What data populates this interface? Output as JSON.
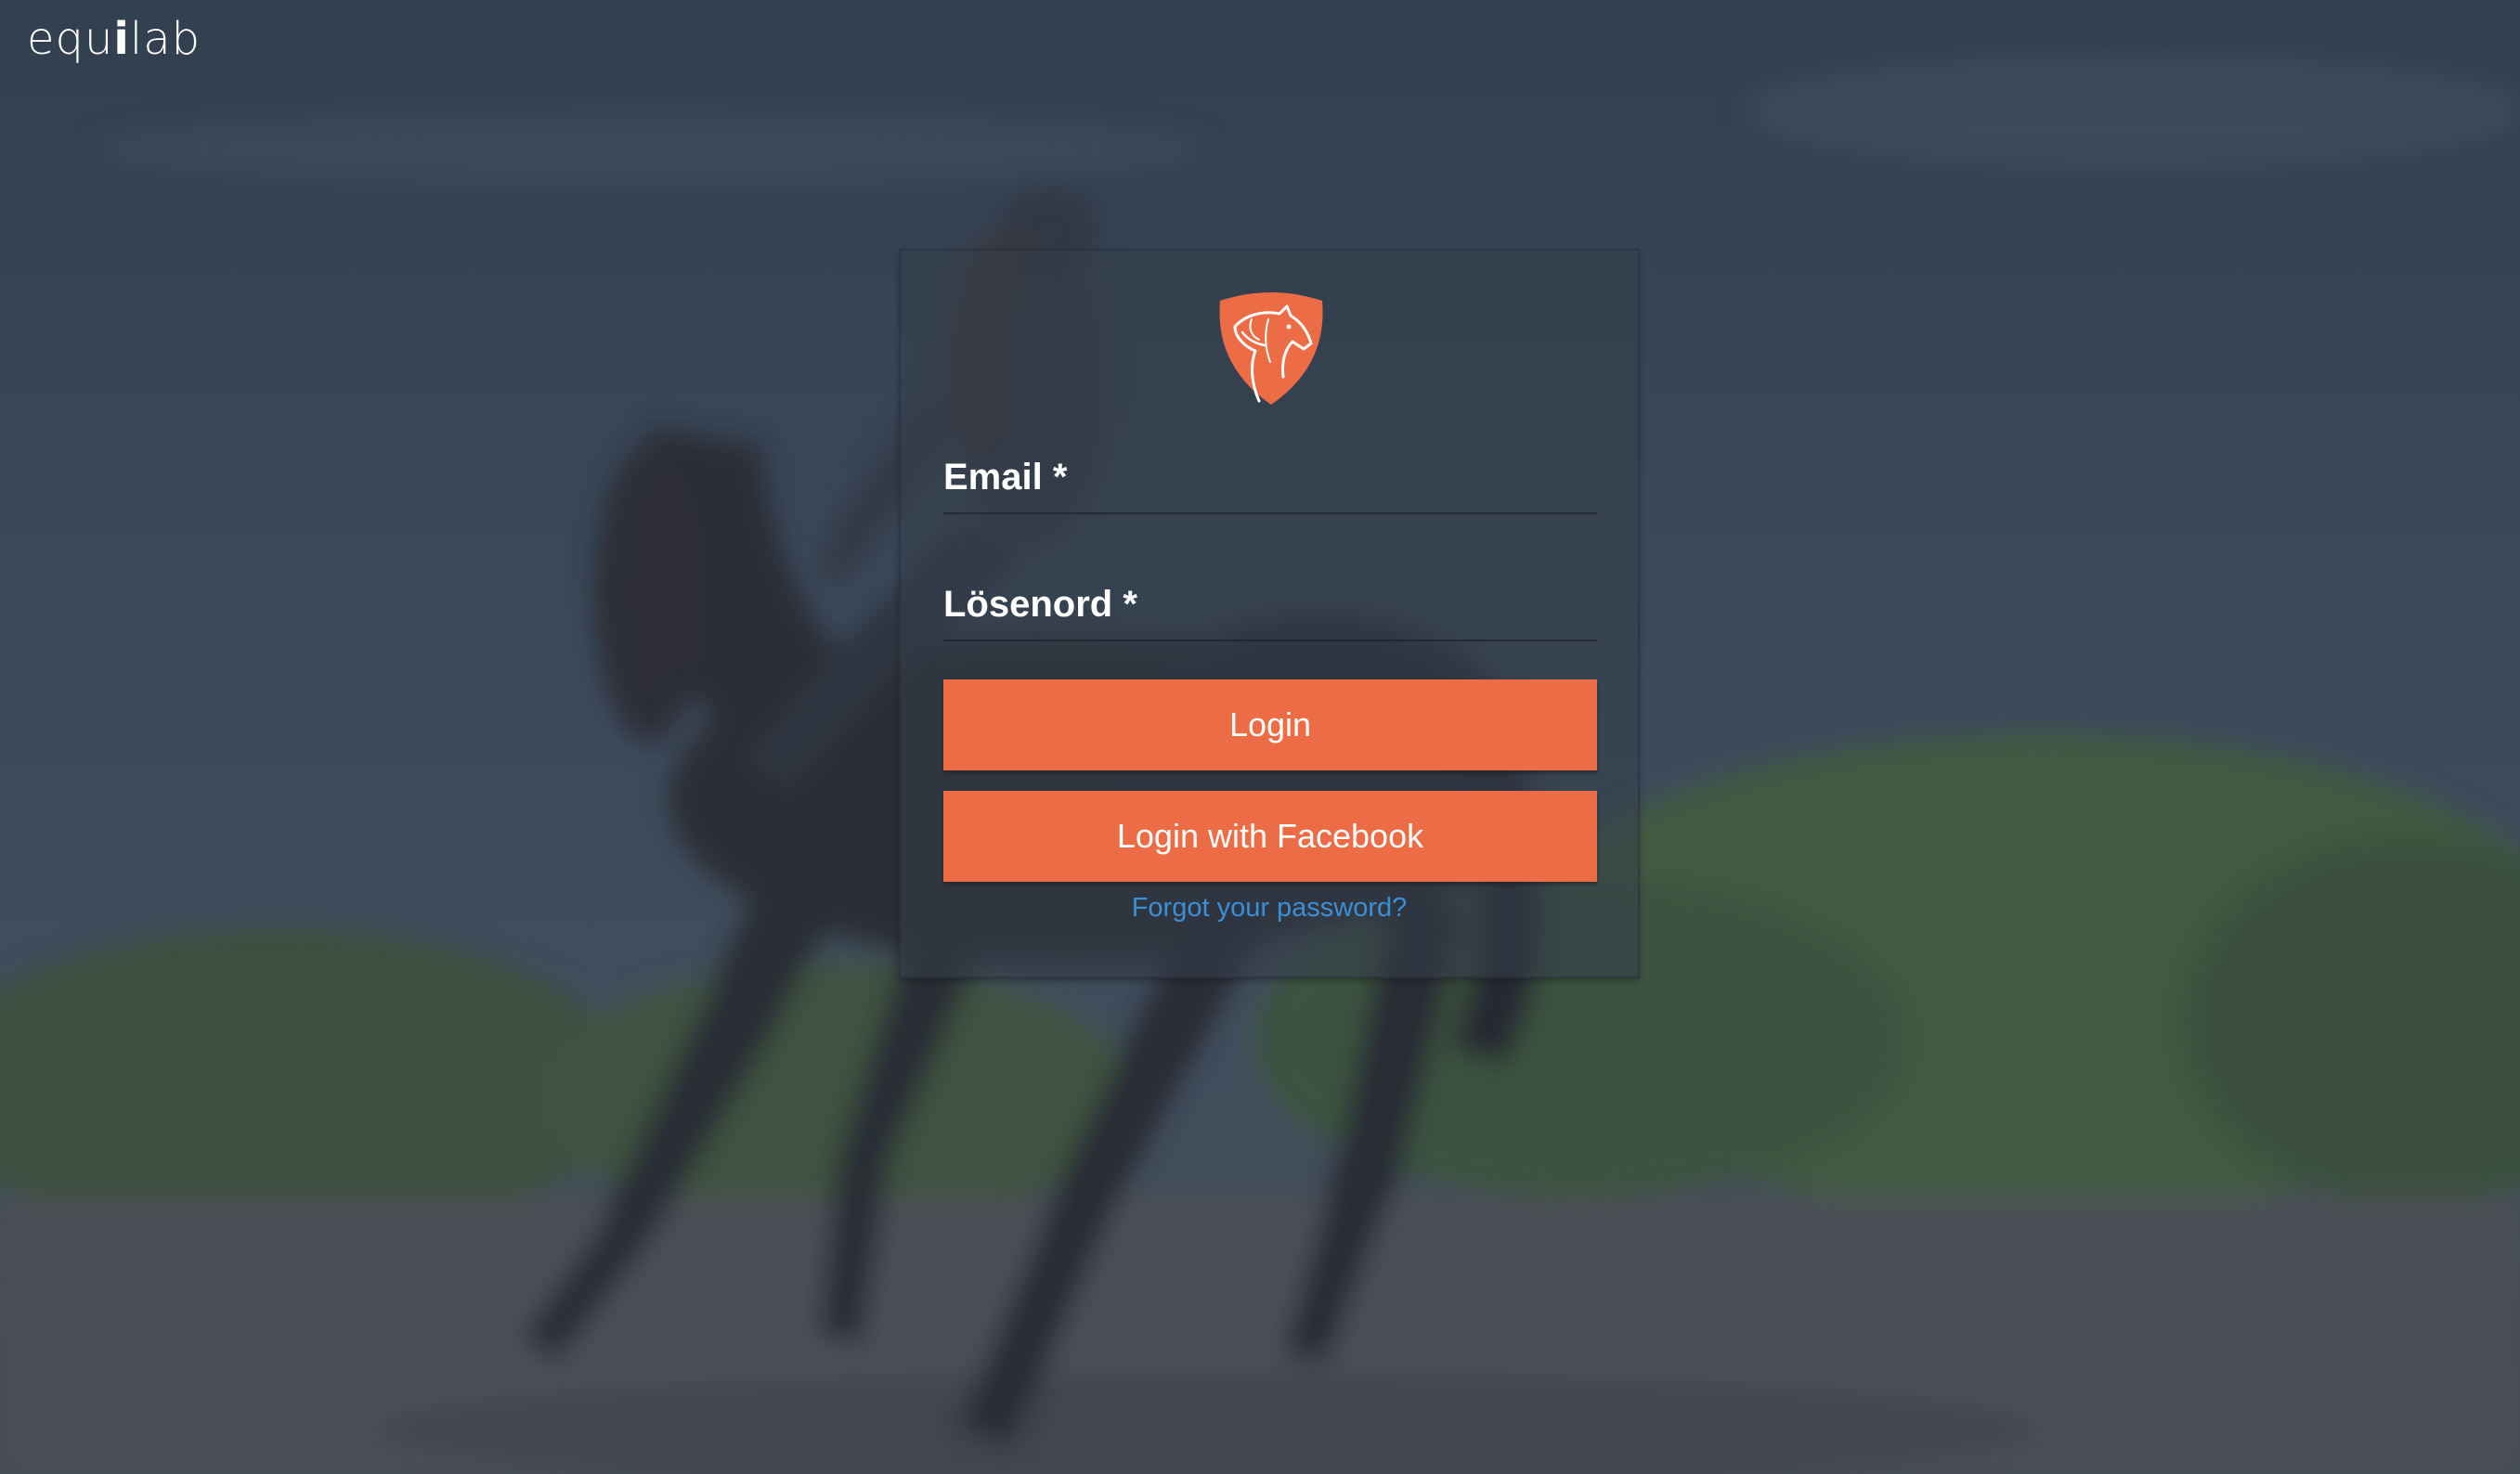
{
  "brand": {
    "name_part1": "equ",
    "name_mark": "i",
    "name_part2": "lab"
  },
  "login_form": {
    "logo_icon": "horse-head-shield-icon",
    "email_label": "Email *",
    "email_value": "",
    "password_label": "Lösenord *",
    "password_value": "",
    "login_button": "Login",
    "facebook_button": "Login with Facebook",
    "forgot_link": "Forgot your password?"
  },
  "colors": {
    "accent": "#ec6c46",
    "link": "#3b8fd6",
    "overlay": "#283442"
  },
  "background": {
    "subject": "horse-rider-photo"
  }
}
